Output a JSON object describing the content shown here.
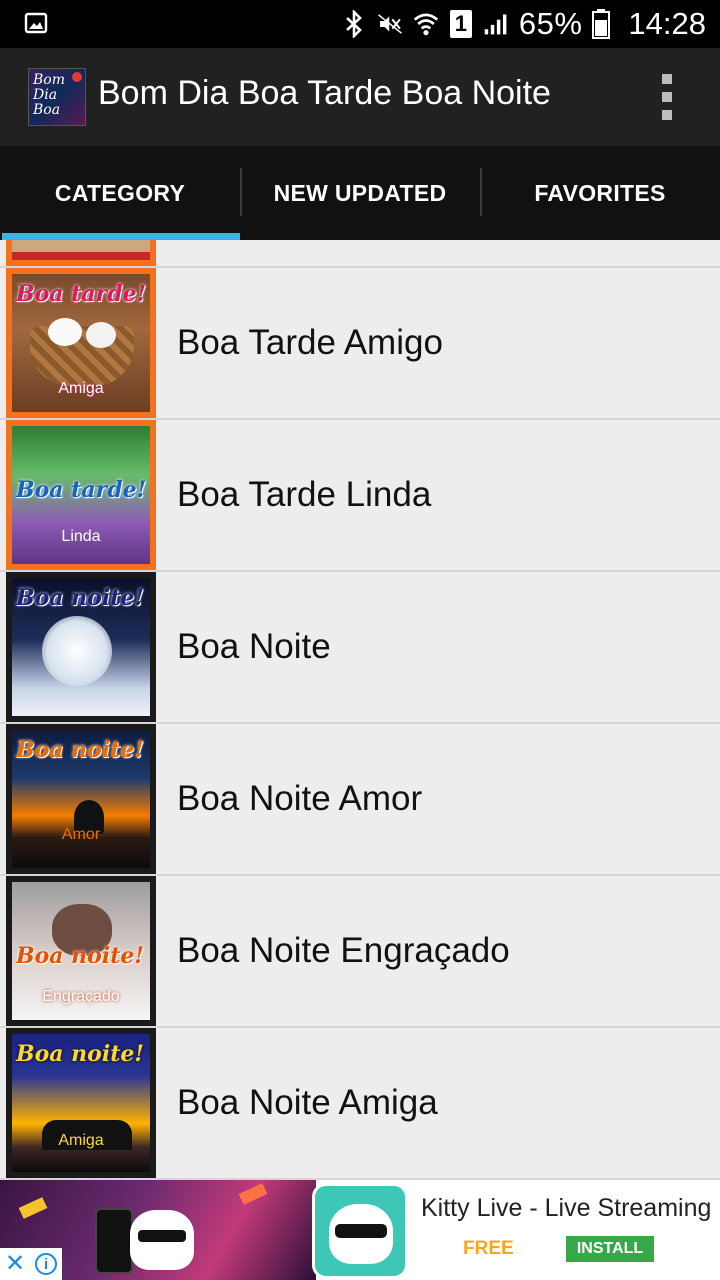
{
  "status_bar": {
    "battery_percent": "65%",
    "time": "14:28",
    "sim_slot": "1",
    "icons": [
      "gallery-icon",
      "bluetooth-icon",
      "mute-icon",
      "wifi-icon",
      "sim-icon",
      "signal-icon",
      "battery-icon"
    ]
  },
  "app_bar": {
    "title": "Bom Dia Boa Tarde Boa Noite",
    "icon_glyph": "Bom Dia Boa",
    "menu_icon": "overflow-menu-icon"
  },
  "tabs": [
    {
      "label": "CATEGORY",
      "selected": true
    },
    {
      "label": "NEW UPDATED",
      "selected": false
    },
    {
      "label": "FAVORITES",
      "selected": false
    }
  ],
  "colors": {
    "tab_indicator": "#33b5e5",
    "appbar": "#212121",
    "thumb_orange": "#f4711d"
  },
  "categories": [
    {
      "label": "",
      "thumb_text": "",
      "thumb_sub": ""
    },
    {
      "label": "Boa Tarde Amigo",
      "thumb_text": "Boa tarde!",
      "thumb_sub": "Amiga"
    },
    {
      "label": "Boa Tarde Linda",
      "thumb_text": "Boa tarde!",
      "thumb_sub": "Linda"
    },
    {
      "label": "Boa Noite",
      "thumb_text": "Boa noite!",
      "thumb_sub": ""
    },
    {
      "label": "Boa Noite Amor",
      "thumb_text": "Boa noite!",
      "thumb_sub": "Amor"
    },
    {
      "label": "Boa Noite Engraçado",
      "thumb_text": "Boa noite!",
      "thumb_sub": "Engraçado"
    },
    {
      "label": "Boa Noite Amiga",
      "thumb_text": "Boa noite!",
      "thumb_sub": "Amiga"
    }
  ],
  "ad": {
    "title": "Kitty Live - Live Streaming",
    "price": "FREE",
    "cta": "INSTALL",
    "close_icon": "close-icon",
    "info_icon": "info-icon"
  }
}
